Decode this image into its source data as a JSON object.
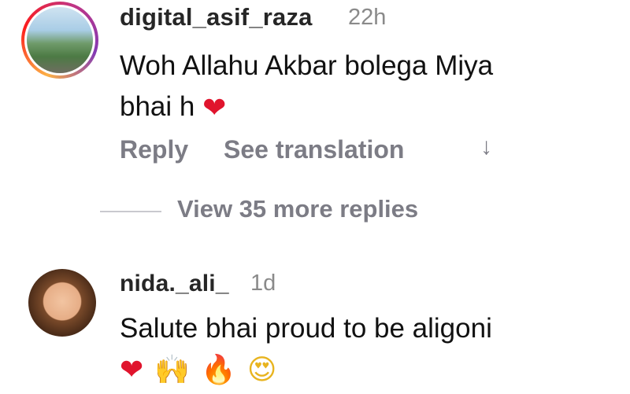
{
  "comments": [
    {
      "username": "digital_asif_raza",
      "timestamp": "22h",
      "text_line1": "Woh Allahu Akbar bolega Miya",
      "text_line2": "bhai h",
      "emoji": "❤",
      "actions": {
        "reply": "Reply",
        "see_translation": "See translation",
        "translate_arrow": "↓"
      },
      "view_replies": "View 35 more replies"
    },
    {
      "username": "nida._ali_",
      "timestamp": "1d",
      "text_line1": "Salute bhai proud to be aligoni",
      "emojis": [
        "❤",
        "🙌",
        "🔥",
        "😍"
      ]
    }
  ],
  "colors": {
    "username": "#262626",
    "timestamp": "#8a8a8a",
    "action": "#7c7c85",
    "heart": "#e0142d",
    "story_ring_start": "#fcb045",
    "story_ring_end": "#833ab4"
  },
  "icons": {
    "avatar_1": "profile-photo-man",
    "avatar_2": "profile-photo-child"
  }
}
